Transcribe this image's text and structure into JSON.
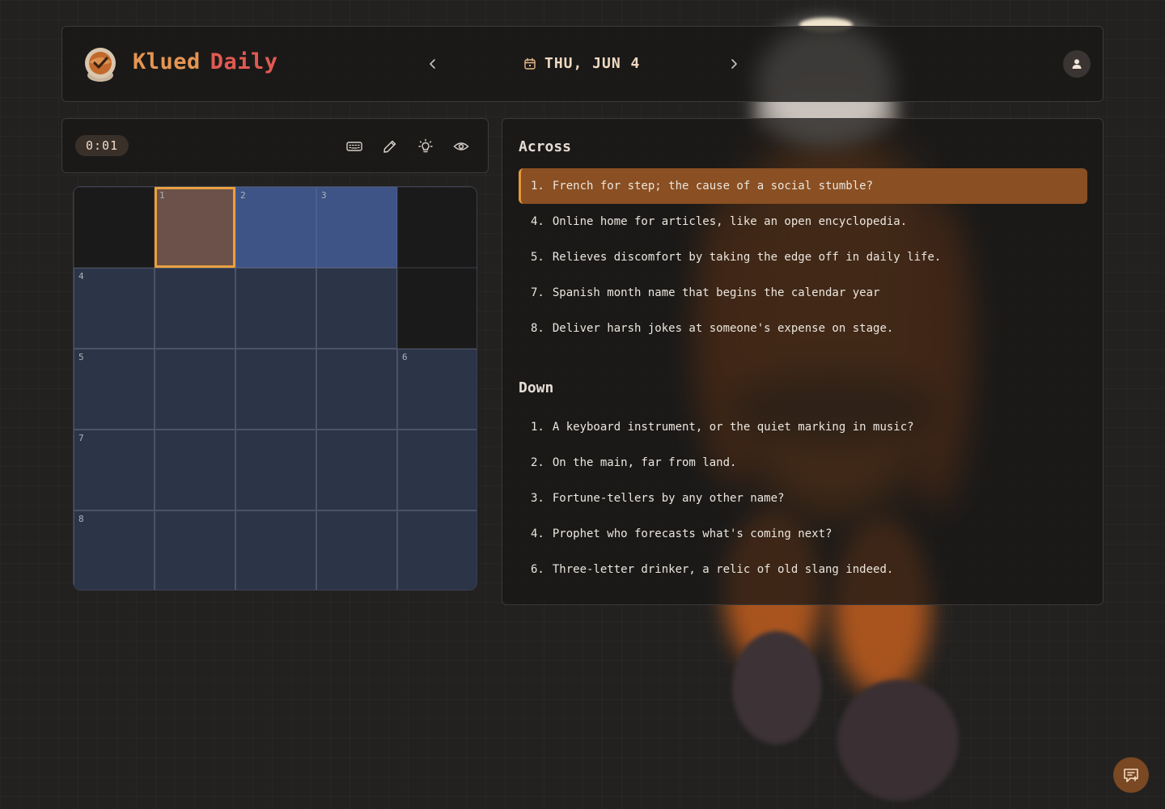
{
  "app": {
    "brand_part1": "Klued",
    "brand_part2": "Daily"
  },
  "header": {
    "date": "THU, JUN 4",
    "icons": {
      "logo": "astronaut-helmet-check-icon",
      "prev": "chevron-left-icon",
      "next": "chevron-right-icon",
      "calendar": "calendar-icon",
      "user": "user-icon"
    }
  },
  "toolbar": {
    "timer": "0:01",
    "tools": [
      "keyboard-icon",
      "pencil-icon",
      "lightbulb-icon",
      "eye-icon"
    ]
  },
  "grid": {
    "rows": 5,
    "cols": 5,
    "cells": [
      [
        {
          "block": true
        },
        {
          "num": "1",
          "state": "active"
        },
        {
          "num": "2",
          "state": "word"
        },
        {
          "num": "3",
          "state": "word"
        },
        {
          "block": true
        }
      ],
      [
        {
          "num": "4"
        },
        {},
        {},
        {},
        {
          "block": true
        }
      ],
      [
        {
          "num": "5"
        },
        {},
        {},
        {},
        {
          "num": "6"
        }
      ],
      [
        {
          "num": "7"
        },
        {},
        {},
        {},
        {}
      ],
      [
        {
          "num": "8"
        },
        {},
        {},
        {},
        {}
      ]
    ]
  },
  "clues": {
    "across_title": "Across",
    "down_title": "Down",
    "across": [
      {
        "num": "1.",
        "text": "French for step; the cause of a social stumble?",
        "active": true
      },
      {
        "num": "4.",
        "text": "Online home for articles, like an open encyclopedia."
      },
      {
        "num": "5.",
        "text": "Relieves discomfort by taking the edge off in daily life."
      },
      {
        "num": "7.",
        "text": "Spanish month name that begins the calendar year"
      },
      {
        "num": "8.",
        "text": "Deliver harsh jokes at someone's expense on stage."
      }
    ],
    "down": [
      {
        "num": "1.",
        "text": "A keyboard instrument, or the quiet marking in music?"
      },
      {
        "num": "2.",
        "text": "On the main, far from land."
      },
      {
        "num": "3.",
        "text": "Fortune-tellers by any other name?"
      },
      {
        "num": "4.",
        "text": "Prophet who forecasts what's coming next?"
      },
      {
        "num": "6.",
        "text": "Three-letter drinker, a relic of old slang indeed."
      }
    ]
  },
  "colors": {
    "accent": "#e8a040",
    "brand_orange": "#e59552",
    "brand_red": "#e05a52",
    "active_clue": "#8a4f22",
    "word_cell": "#3e5486"
  },
  "feedback": {
    "icon": "feedback-chat-icon"
  }
}
